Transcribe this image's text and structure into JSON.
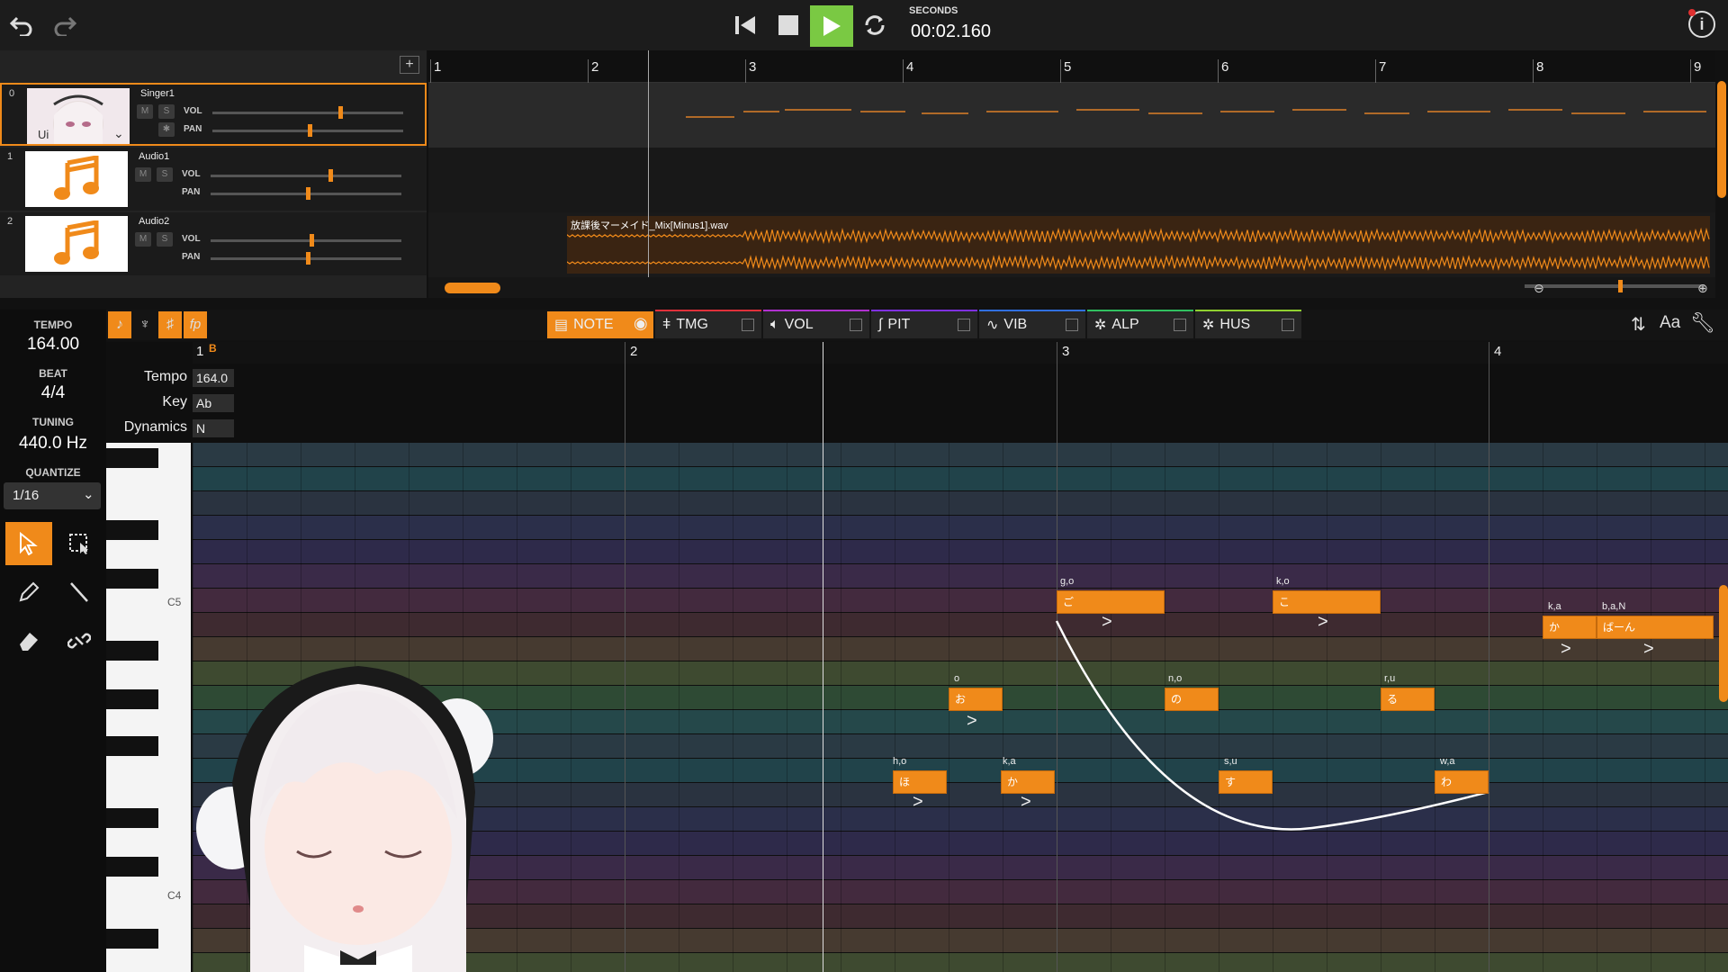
{
  "transport": {
    "time_label": "SECONDS",
    "time_value": "00:02.160"
  },
  "tracks": [
    {
      "index": "0",
      "name": "Singer1",
      "vol_label": "VOL",
      "pan_label": "PAN",
      "m": "M",
      "s": "S",
      "avatar_text": "Ui",
      "vol": 0.66,
      "pan": 0.5
    },
    {
      "index": "1",
      "name": "Audio1",
      "vol_label": "VOL",
      "pan_label": "PAN",
      "m": "M",
      "s": "S",
      "vol": 0.62,
      "pan": 0.5
    },
    {
      "index": "2",
      "name": "Audio2",
      "vol_label": "VOL",
      "pan_label": "PAN",
      "m": "M",
      "s": "S",
      "vol": 0.52,
      "pan": 0.5
    }
  ],
  "arrangement": {
    "bars": [
      "1",
      "2",
      "3",
      "4",
      "5",
      "6",
      "7",
      "8",
      "9"
    ],
    "audio_clip_name": "放課後マーメイド_Mix[Minus1].wav"
  },
  "params": {
    "tempo_label": "TEMPO",
    "tempo_value": "164.00",
    "beat_label": "BEAT",
    "beat_value": "4/4",
    "tuning_label": "TUNING",
    "tuning_value": "440.0 Hz",
    "quantize_label": "QUANTIZE",
    "quantize_value": "1/16"
  },
  "tabs": [
    {
      "label": "NOTE",
      "color": "#f08a1a"
    },
    {
      "label": "TMG",
      "color": "#e0303a"
    },
    {
      "label": "VOL",
      "color": "#b030d0"
    },
    {
      "label": "PIT",
      "color": "#8030e0"
    },
    {
      "label": "VIB",
      "color": "#3070e0"
    },
    {
      "label": "ALP",
      "color": "#30c060"
    },
    {
      "label": "HUS",
      "color": "#90d030"
    }
  ],
  "editor": {
    "bars": [
      "1",
      "2",
      "3",
      "4"
    ],
    "marker_b": "B",
    "lanes": [
      {
        "label": "Tempo",
        "value": "164.0"
      },
      {
        "label": "Key",
        "value": "Ab"
      },
      {
        "label": "Dynamics",
        "value": "N"
      }
    ],
    "octave_c5": "C5",
    "octave_c4": "C4",
    "notes": [
      {
        "phoneme": "h,o",
        "lyric": "ほ"
      },
      {
        "phoneme": "o",
        "lyric": "お"
      },
      {
        "phoneme": "k,a",
        "lyric": "か"
      },
      {
        "phoneme": "g,o",
        "lyric": "ご"
      },
      {
        "phoneme": "n,o",
        "lyric": "の"
      },
      {
        "phoneme": "s,u",
        "lyric": "す"
      },
      {
        "phoneme": "k,o",
        "lyric": "こ"
      },
      {
        "phoneme": "r,u",
        "lyric": "る"
      },
      {
        "phoneme": "w,a",
        "lyric": "わ"
      },
      {
        "phoneme": "k,a",
        "lyric": "か"
      },
      {
        "phoneme": "b,a,N",
        "lyric": "ばーん"
      }
    ],
    "accent": ">"
  },
  "colors": {
    "accent": "#f08a1a",
    "play": "#7ac943"
  }
}
